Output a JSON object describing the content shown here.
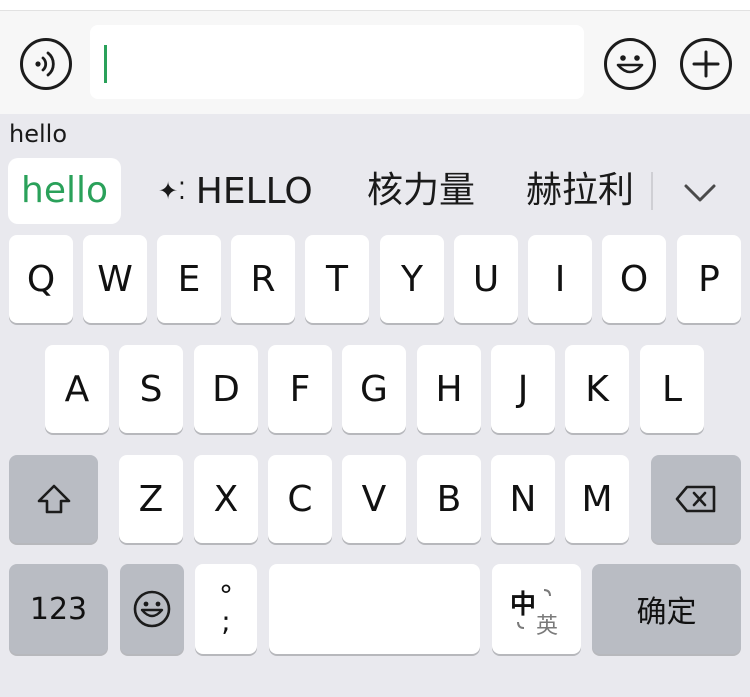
{
  "input_bar": {
    "text_value": ""
  },
  "composing_text": "hello",
  "candidates": [
    {
      "text": "hello"
    },
    {
      "text": "HELLO",
      "icon": "ai-sparkle-icon"
    },
    {
      "text": "核力量"
    },
    {
      "text": "赫拉利"
    }
  ],
  "keyboard": {
    "row1": [
      "Q",
      "W",
      "E",
      "R",
      "T",
      "Y",
      "U",
      "I",
      "O",
      "P"
    ],
    "row2": [
      "A",
      "S",
      "D",
      "F",
      "G",
      "H",
      "J",
      "K",
      "L"
    ],
    "row3": [
      "Z",
      "X",
      "C",
      "V",
      "B",
      "N",
      "M"
    ],
    "numbers_label": "123",
    "punct_top": "°",
    "punct_bottom": ";",
    "lang_zh": "中",
    "lang_en": "英",
    "confirm_label": "确定"
  },
  "colors": {
    "accent": "#2aa15a",
    "keyboard_bg": "#e9e9ee",
    "key_bg": "#ffffff",
    "function_key_bg": "#b9bcc3"
  }
}
